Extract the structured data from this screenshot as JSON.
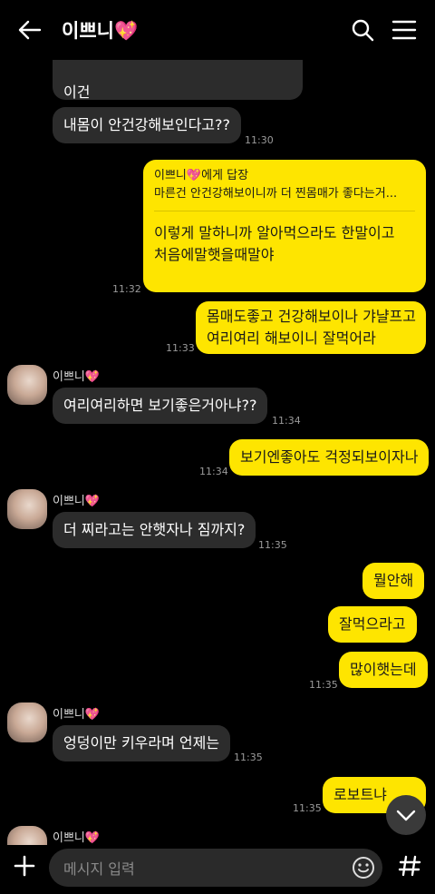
{
  "header": {
    "title": "이쁘니💖"
  },
  "messages": {
    "m1": {
      "text": "이건"
    },
    "m2": {
      "text": "내몸이 안건강해보인다고??",
      "time": "11:30"
    },
    "m3": {
      "reply_to": "이쁘니💖에게 답장",
      "quote": "마른건 안건강해보이니까 더 찐몸매가 좋다는거...",
      "line1": "이렇게 말하니까 알아먹으라도 한말이고",
      "line2": "처음에말햇을때말야",
      "time": "11:32"
    },
    "m4": {
      "line1": "몸매도좋고 건강해보이나 갸냘프고",
      "line2": "여리여리 해보이니 잘먹어라",
      "time": "11:33"
    },
    "m5": {
      "sender": "이쁘니💖",
      "text": "여리여리하면 보기좋은거아냐??",
      "time": "11:34"
    },
    "m6": {
      "text": "보기엔좋아도 걱정되보이자나",
      "time": "11:34"
    },
    "m7": {
      "sender": "이쁘니💖",
      "text": "더 찌라고는 안햇자나 짐까지?",
      "time": "11:35"
    },
    "m8": {
      "text": "뭘안해"
    },
    "m9": {
      "text": "잘먹으라고"
    },
    "m10": {
      "text": "많이햇는데",
      "time": "11:35"
    },
    "m11": {
      "sender": "이쁘니💖",
      "text": "엉덩이만 키우라며 언제는",
      "time": "11:35"
    },
    "m12": {
      "text": "로보트냐",
      "time": "11:35"
    },
    "m13": {
      "sender": "이쁘니💖"
    }
  },
  "composer": {
    "placeholder": "메시지 입력"
  },
  "icons": {
    "back": "arrow-left-icon",
    "search": "search-icon",
    "menu": "hamburger-icon",
    "plus": "plus-icon",
    "emoji": "emoji-icon",
    "hash": "hash-icon",
    "scroll": "chevron-down-icon"
  },
  "colors": {
    "outgoing": "#fee500",
    "incoming": "#2c2c2c",
    "background": "#000000"
  }
}
